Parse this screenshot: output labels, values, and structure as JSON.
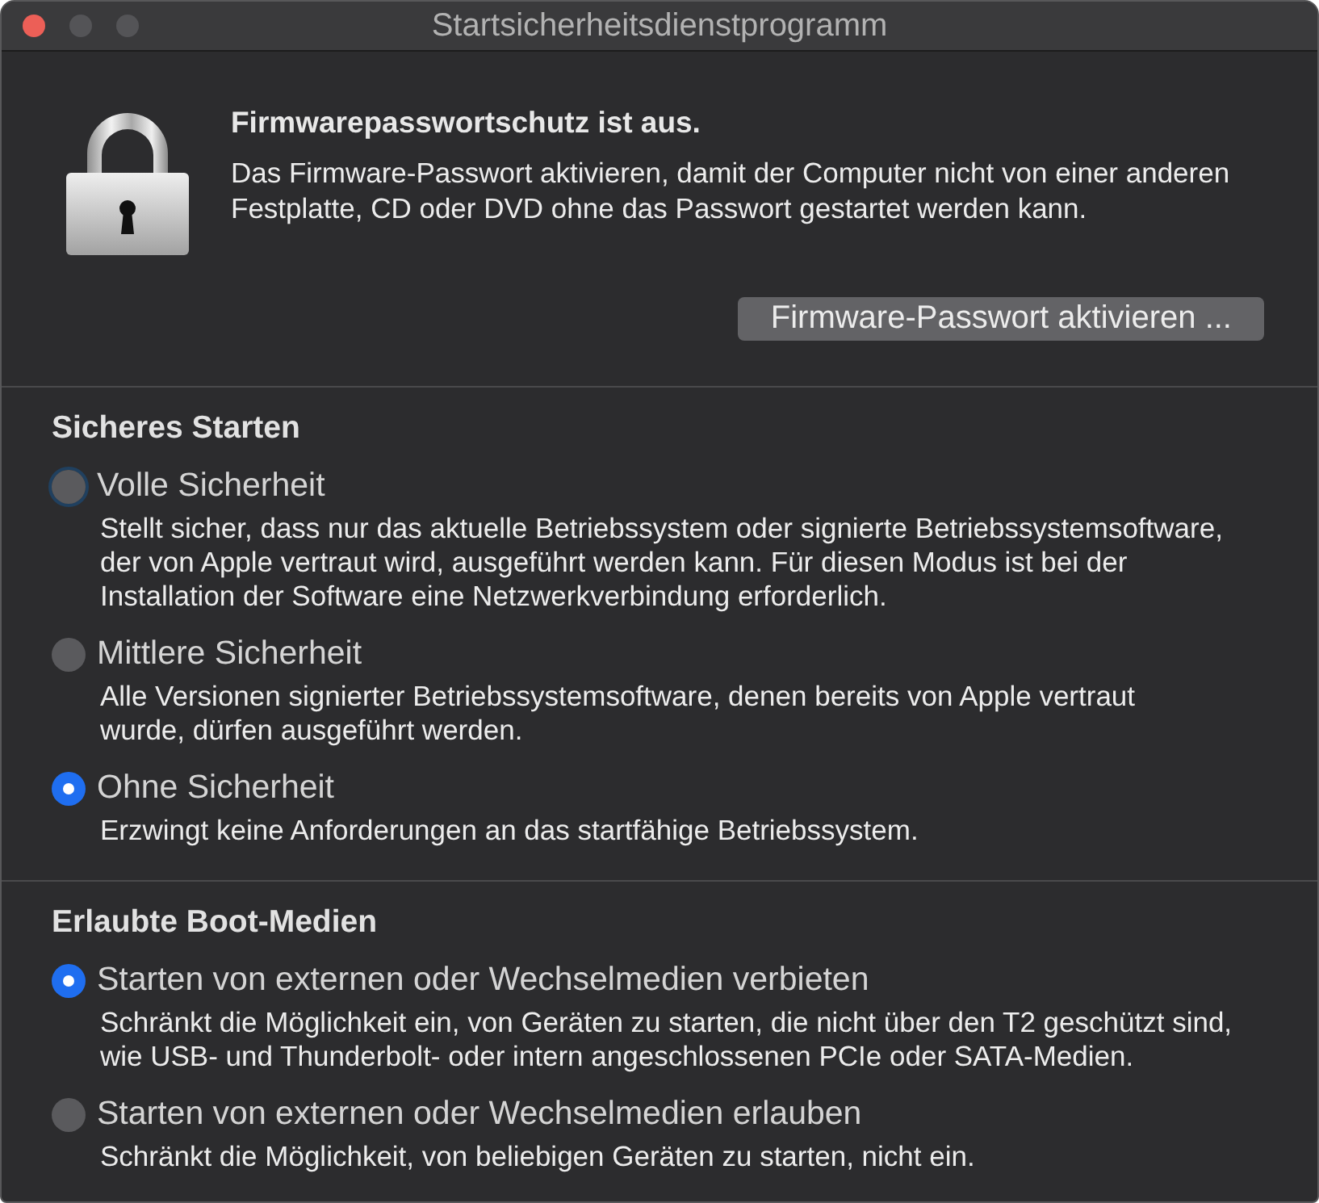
{
  "window": {
    "title": "Startsicherheitsdienstprogramm",
    "controls": [
      {
        "kind": "close",
        "disabled": false
      },
      {
        "kind": "minimize",
        "disabled": true
      },
      {
        "kind": "zoom",
        "disabled": true
      }
    ]
  },
  "firmware": {
    "heading": "Firmwarepasswortschutz ist aus.",
    "description": "Das Firmware-Passwort aktivieren, damit der Computer nicht von einer anderen\nFestplatte, CD oder DVD ohne das Passwort gestartet werden kann.",
    "button": "Firmware-Passwort aktivieren ..."
  },
  "sections": [
    {
      "title": "Sicheres Starten",
      "options": [
        {
          "label": "Volle Sicherheit",
          "description": "Stellt sicher, dass nur das aktuelle Betriebssystem oder signierte Betriebssystemsoftware,\nder von Apple vertraut wird, ausgeführt werden kann. Für diesen Modus ist bei der\nInstallation der Software eine Netzwerkverbindung erforderlich.",
          "selected": false,
          "focused": true
        },
        {
          "label": "Mittlere Sicherheit",
          "description": "Alle Versionen signierter Betriebssystemsoftware, denen bereits von Apple vertraut\nwurde, dürfen ausgeführt werden.",
          "selected": false,
          "focused": false
        },
        {
          "label": "Ohne Sicherheit",
          "description": "Erzwingt keine Anforderungen an das startfähige Betriebssystem.",
          "selected": true,
          "focused": false
        }
      ]
    },
    {
      "title": "Erlaubte Boot-Medien",
      "options": [
        {
          "label": "Starten von externen oder Wechselmedien verbieten",
          "description": "Schränkt die Möglichkeit ein, von Geräten zu starten, die nicht über den T2 geschützt sind,\nwie USB- und Thunderbolt- oder intern angeschlossenen PCIe oder SATA-Medien.",
          "selected": true,
          "focused": false
        },
        {
          "label": "Starten von externen oder Wechselmedien erlauben",
          "description": "Schränkt die Möglichkeit, von beliebigen Geräten zu starten, nicht ein.",
          "selected": false,
          "focused": false
        }
      ]
    }
  ]
}
